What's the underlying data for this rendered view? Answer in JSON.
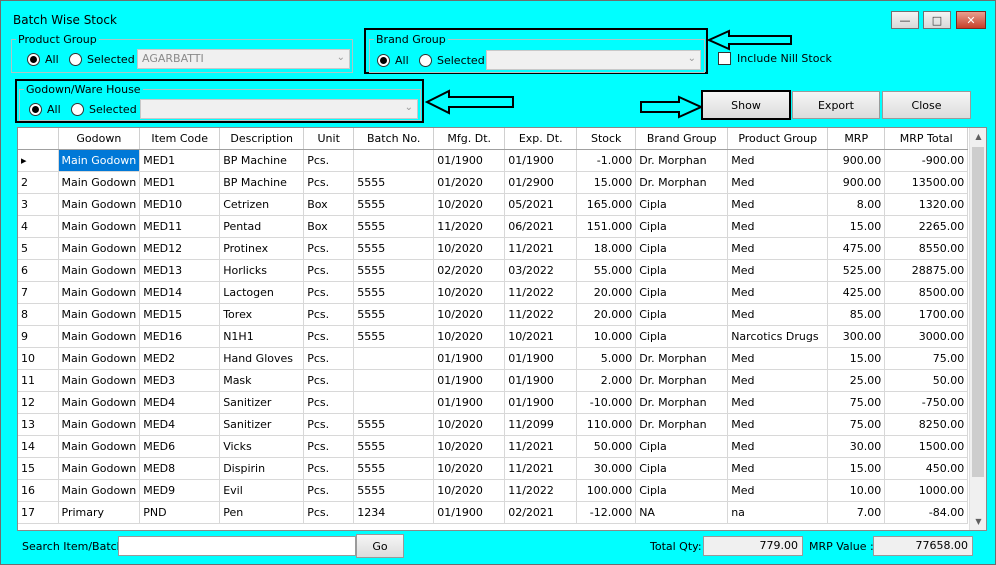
{
  "window": {
    "title": "Batch Wise Stock"
  },
  "product_group": {
    "legend": "Product Group",
    "all_label": "All",
    "selected_label": "Selected",
    "value": "AGARBATTI"
  },
  "brand_group": {
    "legend": "Brand Group",
    "all_label": "All",
    "selected_label": "Selected",
    "value": ""
  },
  "godown": {
    "legend": "Godown/Ware House",
    "all_label": "All",
    "selected_label": "Selected",
    "value": ""
  },
  "include_nill_label": "Include Nill  Stock",
  "buttons": {
    "show": "Show",
    "export": "Export",
    "close": "Close",
    "go": "Go"
  },
  "grid": {
    "columns": [
      "",
      "Godown",
      "Item Code",
      "Description",
      "Unit",
      "Batch No.",
      "Mfg. Dt.",
      "Exp. Dt.",
      "Stock",
      "Brand Group",
      "Product Group",
      "MRP",
      "MRP Total"
    ],
    "rows": [
      [
        "",
        "Main Godown",
        "MED1",
        "BP Machine",
        "Pcs.",
        "",
        "01/1900",
        "01/1900",
        "-1.000",
        "Dr. Morphan",
        "Med",
        "900.00",
        "-900.00"
      ],
      [
        "2",
        "Main Godown",
        "MED1",
        "BP Machine",
        "Pcs.",
        "5555",
        "01/2020",
        "01/2900",
        "15.000",
        "Dr. Morphan",
        "Med",
        "900.00",
        "13500.00"
      ],
      [
        "3",
        "Main Godown",
        "MED10",
        "Cetrizen",
        "Box",
        "5555",
        "10/2020",
        "05/2021",
        "165.000",
        "Cipla",
        "Med",
        "8.00",
        "1320.00"
      ],
      [
        "4",
        "Main Godown",
        "MED11",
        "Pentad",
        "Box",
        "5555",
        "11/2020",
        "06/2021",
        "151.000",
        "Cipla",
        "Med",
        "15.00",
        "2265.00"
      ],
      [
        "5",
        "Main Godown",
        "MED12",
        "Protinex",
        "Pcs.",
        "5555",
        "10/2020",
        "11/2021",
        "18.000",
        "Cipla",
        "Med",
        "475.00",
        "8550.00"
      ],
      [
        "6",
        "Main Godown",
        "MED13",
        "Horlicks",
        "Pcs.",
        "5555",
        "02/2020",
        "03/2022",
        "55.000",
        "Cipla",
        "Med",
        "525.00",
        "28875.00"
      ],
      [
        "7",
        "Main Godown",
        "MED14",
        "Lactogen",
        "Pcs.",
        "5555",
        "10/2020",
        "11/2022",
        "20.000",
        "Cipla",
        "Med",
        "425.00",
        "8500.00"
      ],
      [
        "8",
        "Main Godown",
        "MED15",
        "Torex",
        "Pcs.",
        "5555",
        "10/2020",
        "11/2022",
        "20.000",
        "Cipla",
        "Med",
        "85.00",
        "1700.00"
      ],
      [
        "9",
        "Main Godown",
        "MED16",
        "N1H1",
        "Pcs.",
        "5555",
        "10/2020",
        "10/2021",
        "10.000",
        "Cipla",
        "Narcotics Drugs",
        "300.00",
        "3000.00"
      ],
      [
        "10",
        "Main Godown",
        "MED2",
        "Hand Gloves",
        "Pcs.",
        "",
        "01/1900",
        "01/1900",
        "5.000",
        "Dr. Morphan",
        "Med",
        "15.00",
        "75.00"
      ],
      [
        "11",
        "Main Godown",
        "MED3",
        "Mask",
        "Pcs.",
        "",
        "01/1900",
        "01/1900",
        "2.000",
        "Dr. Morphan",
        "Med",
        "25.00",
        "50.00"
      ],
      [
        "12",
        "Main Godown",
        "MED4",
        "Sanitizer",
        "Pcs.",
        "",
        "01/1900",
        "01/1900",
        "-10.000",
        "Dr. Morphan",
        "Med",
        "75.00",
        "-750.00"
      ],
      [
        "13",
        "Main Godown",
        "MED4",
        "Sanitizer",
        "Pcs.",
        "5555",
        "10/2020",
        "11/2099",
        "110.000",
        "Dr. Morphan",
        "Med",
        "75.00",
        "8250.00"
      ],
      [
        "14",
        "Main Godown",
        "MED6",
        "Vicks",
        "Pcs.",
        "5555",
        "10/2020",
        "11/2021",
        "50.000",
        "Cipla",
        "Med",
        "30.00",
        "1500.00"
      ],
      [
        "15",
        "Main Godown",
        "MED8",
        "Dispirin",
        "Pcs.",
        "5555",
        "10/2020",
        "11/2021",
        "30.000",
        "Cipla",
        "Med",
        "15.00",
        "450.00"
      ],
      [
        "16",
        "Main Godown",
        "MED9",
        "Evil",
        "Pcs.",
        "5555",
        "10/2020",
        "11/2022",
        "100.000",
        "Cipla",
        "Med",
        "10.00",
        "1000.00"
      ],
      [
        "17",
        "Primary",
        "PND",
        "Pen",
        "Pcs.",
        "1234",
        "01/1900",
        "02/2021",
        "-12.000",
        "NA",
        "na",
        "7.00",
        "-84.00"
      ]
    ]
  },
  "footer": {
    "search_label": "Search Item/Batch:",
    "search_value": "",
    "total_qty_label": "Total Qty:",
    "total_qty": "779.00",
    "mrp_value_label": "MRP Value :",
    "mrp_value": "77658.00"
  }
}
